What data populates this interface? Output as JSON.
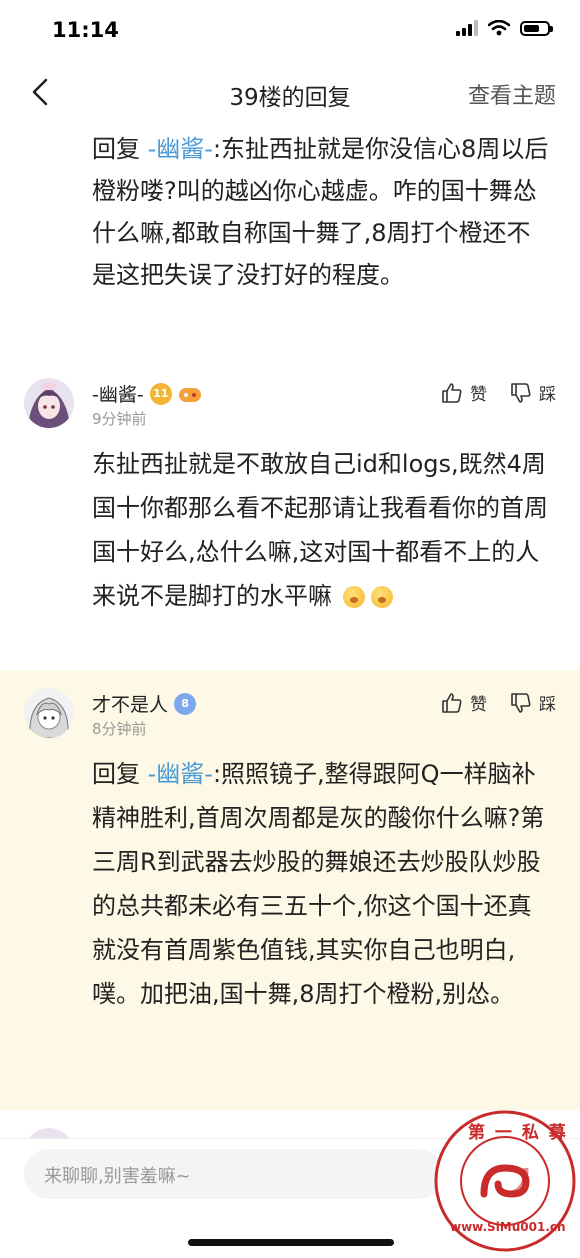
{
  "status": {
    "time": "11:14"
  },
  "nav": {
    "title": "39楼的回复",
    "topic_link": "查看主题"
  },
  "origin": {
    "prefix": "回复 ",
    "mention": "-幽酱-",
    "text": ":东扯西扯就是你没信心8周以后橙粉喽?叫的越凶你心越虚。咋的国十舞怂什么嘛,都敢自称国十舞了,8周打个橙还不是这把失误了没打好的程度。"
  },
  "replies": [
    {
      "author": "-幽酱-",
      "level": "11",
      "time": "9分钟前",
      "like_label": "赞",
      "dislike_label": "踩",
      "text": "东扯西扯就是不敢放自己id和logs,既然4周国十你都那么看不起那请让我看看你的首周国十好么,怂什么嘛,这对国十都看不上的人来说不是脚打的水平嘛"
    },
    {
      "author": "才不是人",
      "level": "8",
      "time": "8分钟前",
      "like_label": "赞",
      "dislike_label": "踩",
      "prefix": "回复 ",
      "mention": "-幽酱-",
      "text": ":照照镜子,整得跟阿Q一样脑补精神胜利,首周次周都是灰的酸你什么嘛?第三周R到武器去炒股的舞娘还去炒股队炒股的总共都未必有三五十个,你这个国十还真就没有首周紫色值钱,其实你自己也明白,噗。加把油,国十舞,8周打个橙粉,别怂。"
    }
  ],
  "input": {
    "placeholder": "来聊聊,别害羞嘛~"
  },
  "watermark": {
    "top_text": "第 一 私 募",
    "bottom_text": "www.SiMu001.cn"
  },
  "colors": {
    "mention": "#4a9ad8",
    "highlight_bg": "#fdf9e6",
    "watermark": "#c92b2b"
  }
}
